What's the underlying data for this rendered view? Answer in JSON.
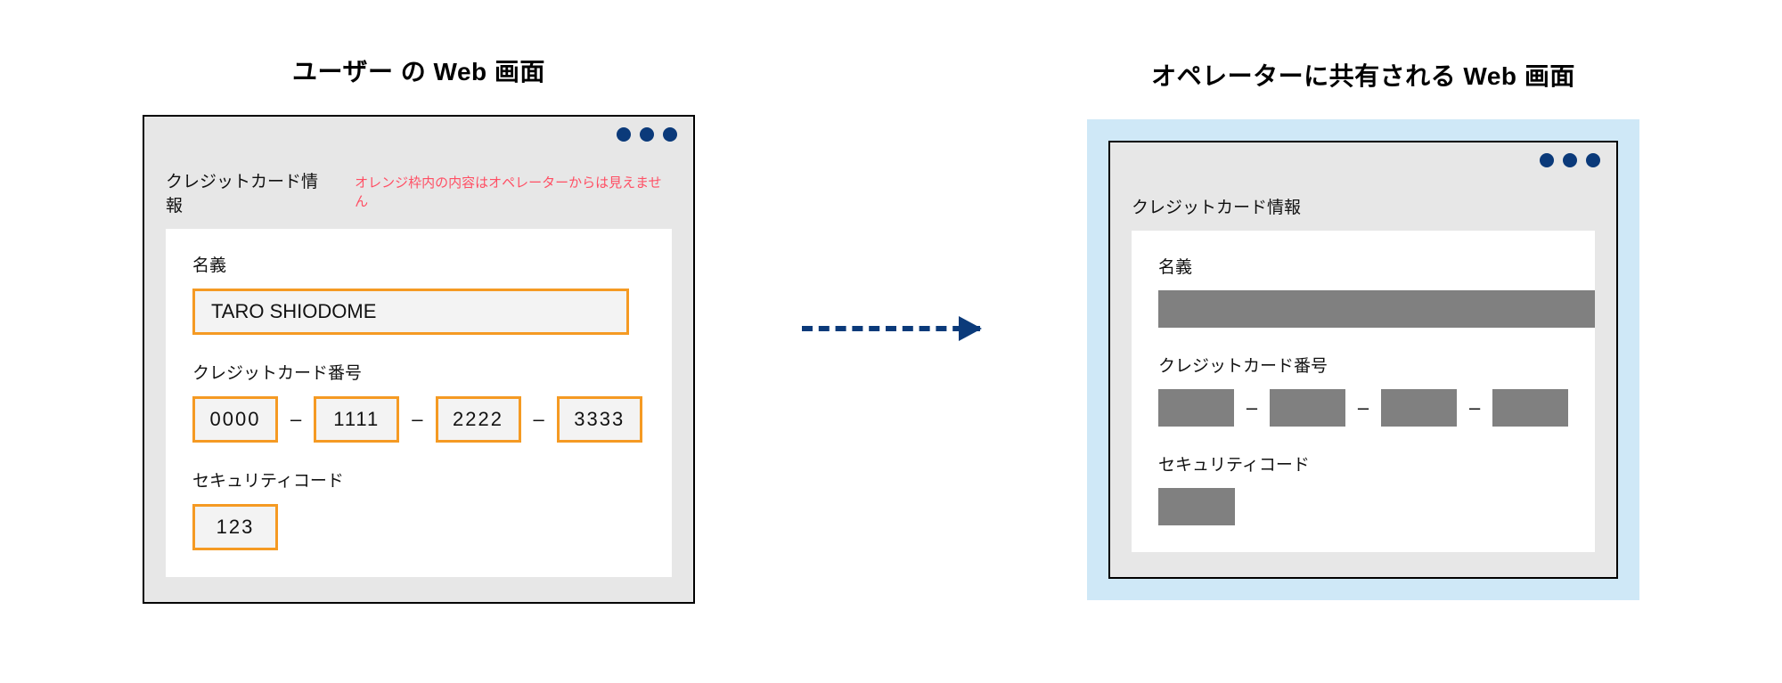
{
  "user_panel": {
    "title": "ユーザー の Web 画面",
    "heading": "クレジットカード情報",
    "note": "オレンジ枠内の内容はオペレーターからは見えません",
    "name_label": "名義",
    "name_value": "TARO SHIODOME",
    "cc_label": "クレジットカード番号",
    "cc_segments": [
      "0000",
      "1111",
      "2222",
      "3333"
    ],
    "sec_label": "セキュリティコード",
    "sec_value": "123",
    "dash": "–"
  },
  "operator_panel": {
    "title": "オペレーターに共有される Web 画面",
    "heading": "クレジットカード情報",
    "name_label": "名義",
    "cc_label": "クレジットカード番号",
    "sec_label": "セキュリティコード",
    "dash": "–"
  }
}
